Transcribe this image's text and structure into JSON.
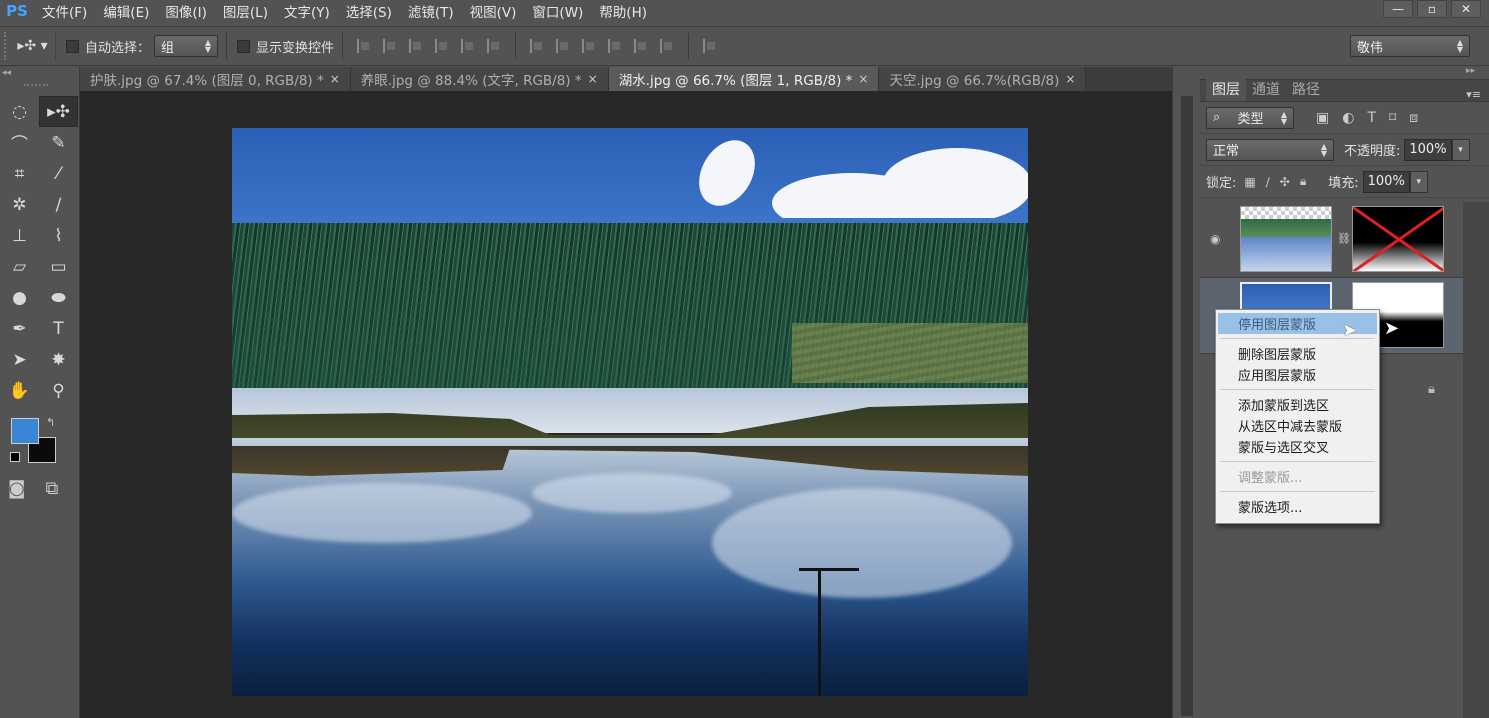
{
  "app": {
    "logo": "PS"
  },
  "menu": [
    "文件(F)",
    "编辑(E)",
    "图像(I)",
    "图层(L)",
    "文字(Y)",
    "选择(S)",
    "滤镜(T)",
    "视图(V)",
    "窗口(W)",
    "帮助(H)"
  ],
  "window_controls": [
    "—",
    "▫",
    "✕"
  ],
  "options": {
    "auto_select_label": "自动选择：",
    "auto_select_value": "组",
    "show_transform_label": "显示变换控件",
    "workspace_value": "敬伟"
  },
  "tabs": [
    {
      "label": "护肤.jpg @ 67.4% (图层 0, RGB/8) *",
      "close": "×"
    },
    {
      "label": "养眼.jpg @ 88.4% (文字, RGB/8) *",
      "close": "×"
    },
    {
      "label": "湖水.jpg @ 66.7% (图层 1, RGB/8) *",
      "close": "×"
    },
    {
      "label": "天空.jpg @ 66.7%(RGB/8)",
      "close": "×"
    }
  ],
  "colors": {
    "foreground": "#3a86d4",
    "background": "#0b0b0b",
    "accent": "#99c0e6"
  },
  "layers_panel": {
    "tabs": [
      "图层",
      "通道",
      "路径"
    ],
    "filter_kind": "类型",
    "blend_mode": "正常",
    "opacity_label": "不透明度:",
    "opacity_value": "100%",
    "lock_label": "锁定:",
    "fill_label": "填充:",
    "fill_value": "100%"
  },
  "context_menu": {
    "items": [
      {
        "label": "停用图层蒙版",
        "state": "highlighted"
      },
      {
        "label": "删除图层蒙版",
        "state": "normal"
      },
      {
        "label": "应用图层蒙版",
        "state": "normal"
      },
      {
        "label": "添加蒙版到选区",
        "state": "normal"
      },
      {
        "label": "从选区中减去蒙版",
        "state": "normal"
      },
      {
        "label": "蒙版与选区交叉",
        "state": "normal"
      },
      {
        "label": "调整蒙版...",
        "state": "disabled"
      },
      {
        "label": "蒙版选项...",
        "state": "normal"
      }
    ]
  }
}
